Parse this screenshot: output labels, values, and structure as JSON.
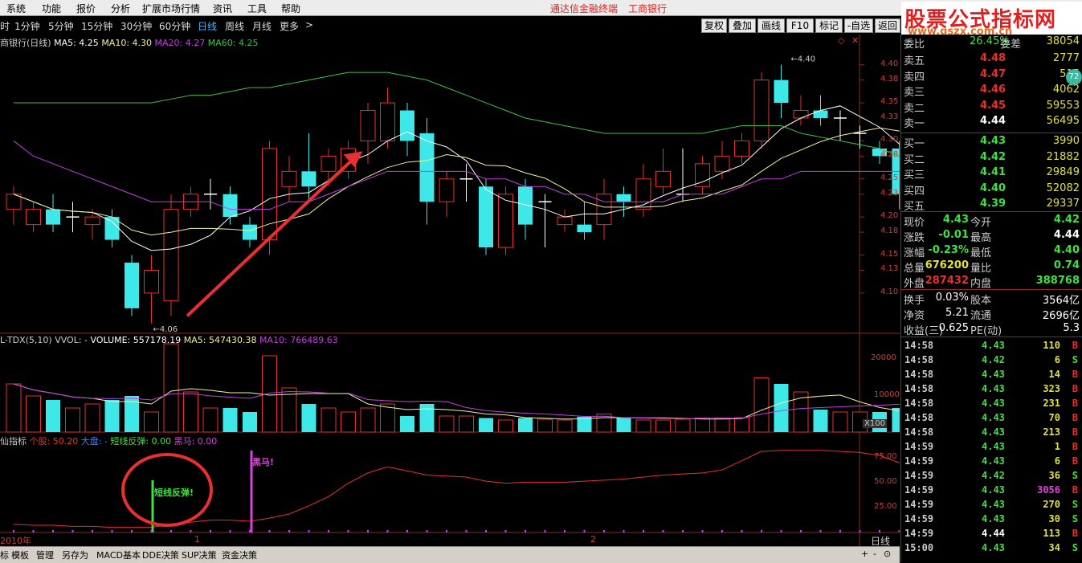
{
  "menu": [
    "系统",
    "功能",
    "报价",
    "分析",
    "扩展市场行情",
    "资讯",
    "工具",
    "帮助"
  ],
  "app_title": "通达信金融终端",
  "app_stock": "工商银行",
  "periods": [
    "时",
    "1分钟",
    "5分钟",
    "15分钟",
    "30分钟",
    "60分钟",
    "日线",
    "周线",
    "月线",
    "更多"
  ],
  "active_period": "日线",
  "period_more_arrow": ">",
  "toolbar_buttons": [
    "复权",
    "叠加",
    "画线",
    "F10",
    "标记",
    "-自选",
    "返回"
  ],
  "watermark": {
    "title": "股票公式指标网",
    "url": "www.gszx.com.cn",
    "badge": "72"
  },
  "chart_header": {
    "name": "商银行(日线)",
    "ma5": "MA5: 4.25",
    "ma10": "MA10: 4.30",
    "ma20": "MA20: 4.27",
    "ma60": "MA60: 4.25"
  },
  "price_axis": [
    "4.40",
    "4.38",
    "4.35",
    "4.33",
    "4.30",
    "4.28",
    "4.25",
    "4.23",
    "4.20",
    "4.18",
    "4.15",
    "4.13",
    "4.10"
  ],
  "price_marks": {
    "high": "4.40",
    "low": "4.06"
  },
  "vol_header": {
    "name": "L-TDX(5,10)",
    "vol": "VVOL: -",
    "volume": "VOLUME: 557178.19",
    "ma5": "MA5: 547430.38",
    "ma10": "MA10: 766489.63"
  },
  "vol_axis": [
    "20000",
    "10000"
  ],
  "vol_unit": "X100",
  "ind_header": {
    "name": "仙指标",
    "ge": "个股: 50.20",
    "da": "大盘: -",
    "dxft": "短线反弹: 0.00",
    "hm": "黑马: 0.00"
  },
  "ind_axis": [
    "75.00",
    "50.00",
    "25.00"
  ],
  "ind_labels": {
    "rebound": "短线反弹!",
    "horse": "黑马!"
  },
  "time_axis": {
    "start": "2010年",
    "m1": "1",
    "m2": "2",
    "period": "日线"
  },
  "bottom_tabs": [
    "标",
    "模板",
    "管理",
    "另存为",
    "MACD基本",
    "DDE决策",
    "SUP决策",
    "资金决策"
  ],
  "quote": {
    "top_label": "委比",
    "top_value": "26.45%",
    "top_label2": "委差",
    "top_value2": "38054",
    "sell": [
      {
        "n": "卖五",
        "p": "4.48",
        "v": "2777"
      },
      {
        "n": "卖四",
        "p": "4.47",
        "v": "515"
      },
      {
        "n": "卖三",
        "p": "4.46",
        "v": "4062"
      },
      {
        "n": "卖二",
        "p": "4.45",
        "v": "59553"
      },
      {
        "n": "卖一",
        "p": "4.44",
        "v": "56495"
      }
    ],
    "buy": [
      {
        "n": "买一",
        "p": "4.43",
        "v": "3990"
      },
      {
        "n": "买二",
        "p": "4.42",
        "v": "21882"
      },
      {
        "n": "买三",
        "p": "4.41",
        "v": "29849"
      },
      {
        "n": "买四",
        "p": "4.40",
        "v": "52082"
      },
      {
        "n": "买五",
        "p": "4.39",
        "v": "29337"
      }
    ],
    "stats": [
      {
        "l1": "现价",
        "v1": "4.43",
        "l2": "今开",
        "v2": "4.42"
      },
      {
        "l1": "涨跌",
        "v1": "-0.01",
        "l2": "最高",
        "v2": "4.44"
      },
      {
        "l1": "涨幅",
        "v1": "-0.23%",
        "l2": "最低",
        "v2": "4.40"
      },
      {
        "l1": "总量",
        "v1": "676200",
        "l2": "量比",
        "v2": "0.74"
      },
      {
        "l1": "外盘",
        "v1": "287432",
        "l2": "内盘",
        "v2": "388768"
      }
    ],
    "stats2": [
      {
        "l1": "换手",
        "v1": "0.03%",
        "l2": "股本",
        "v2": "3564亿"
      },
      {
        "l1": "净资",
        "v1": "5.21",
        "l2": "流通",
        "v2": "2696亿"
      },
      {
        "l1": "收益(三)",
        "v1": "0.625",
        "l2": "PE(动)",
        "v2": "5.3"
      }
    ]
  },
  "ticks": [
    {
      "t": "14:58",
      "p": "4.43",
      "v": "110",
      "s": "B"
    },
    {
      "t": "14:58",
      "p": "4.42",
      "v": "6",
      "s": "S"
    },
    {
      "t": "14:58",
      "p": "4.43",
      "v": "14",
      "s": "B"
    },
    {
      "t": "14:58",
      "p": "4.43",
      "v": "323",
      "s": "B"
    },
    {
      "t": "14:58",
      "p": "4.43",
      "v": "231",
      "s": "B"
    },
    {
      "t": "14:58",
      "p": "4.43",
      "v": "70",
      "s": "B"
    },
    {
      "t": "14:58",
      "p": "4.43",
      "v": "213",
      "s": "B"
    },
    {
      "t": "14:59",
      "p": "4.43",
      "v": "1",
      "s": "B"
    },
    {
      "t": "14:59",
      "p": "4.43",
      "v": "6",
      "s": "B"
    },
    {
      "t": "14:59",
      "p": "4.42",
      "v": "36",
      "s": "S"
    },
    {
      "t": "14:59",
      "p": "4.43",
      "v": "3056",
      "s": "B"
    },
    {
      "t": "14:59",
      "p": "4.43",
      "v": "270",
      "s": "S"
    },
    {
      "t": "14:59",
      "p": "4.43",
      "v": "30",
      "s": "S"
    },
    {
      "t": "14:59",
      "p": "4.44",
      "v": "113",
      "s": "B"
    },
    {
      "t": "15:00",
      "p": "4.43",
      "v": "34",
      "s": "S"
    }
  ],
  "scroll_controls": [
    "+",
    "-",
    "⊙",
    "⊗"
  ],
  "colors": {
    "up": "#e8302a",
    "down": "#3fe8e8",
    "ma5": "#ffffff",
    "ma10": "#f2f0a0",
    "ma20": "#c040e0",
    "ma60": "#40c040",
    "axis": "#8a2a24",
    "arrow": "#e83030"
  }
}
